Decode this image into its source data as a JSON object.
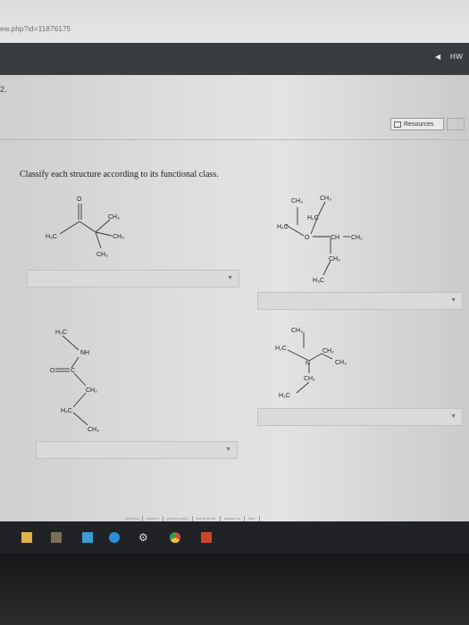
{
  "browser": {
    "url_fragment": "ew.php?id=11876175"
  },
  "nav": {
    "hw_label": "HW"
  },
  "page": {
    "left_marker": "2.",
    "resources_label": "Resources",
    "prompt": "Classify each structure according to its functional class."
  },
  "structures": [
    {
      "labels": {
        "o": "O",
        "h3c": "H₃C",
        "ch3_a": "CH₃",
        "ch3_b": "CH₃",
        "ch3_c": "CH₃"
      }
    },
    {
      "labels": {
        "ch3_a": "CH₃",
        "ch3_b": "CH₃",
        "h2c_a": "H₂C",
        "h2c_b": "H₂C",
        "o": "O",
        "ch": "CH",
        "ch2": "CH₂",
        "ch3_c": "CH₃",
        "h3c": "H₃C"
      }
    },
    {
      "labels": {
        "h3c": "H₃C",
        "nh": "NH",
        "o": "O",
        "c": "C",
        "ch2": "CH₂",
        "h2c": "H₂C",
        "ch3": "CH₃"
      }
    },
    {
      "labels": {
        "ch3_a": "CH₃",
        "h2c": "H₂C",
        "ch2_a": "CH₂",
        "ch3_b": "CH₃",
        "n": "N",
        "ch2_b": "CH₂",
        "h3c": "H₃C"
      }
    }
  ],
  "footer": {
    "links": [
      "about us",
      "careers",
      "privacy policy",
      "terms of use",
      "contact us",
      "help"
    ]
  },
  "taskbar": {
    "icons": [
      "file-explorer-icon",
      "store-icon",
      "mail-icon",
      "edge-icon",
      "settings-icon",
      "chrome-icon",
      "app-icon"
    ]
  }
}
